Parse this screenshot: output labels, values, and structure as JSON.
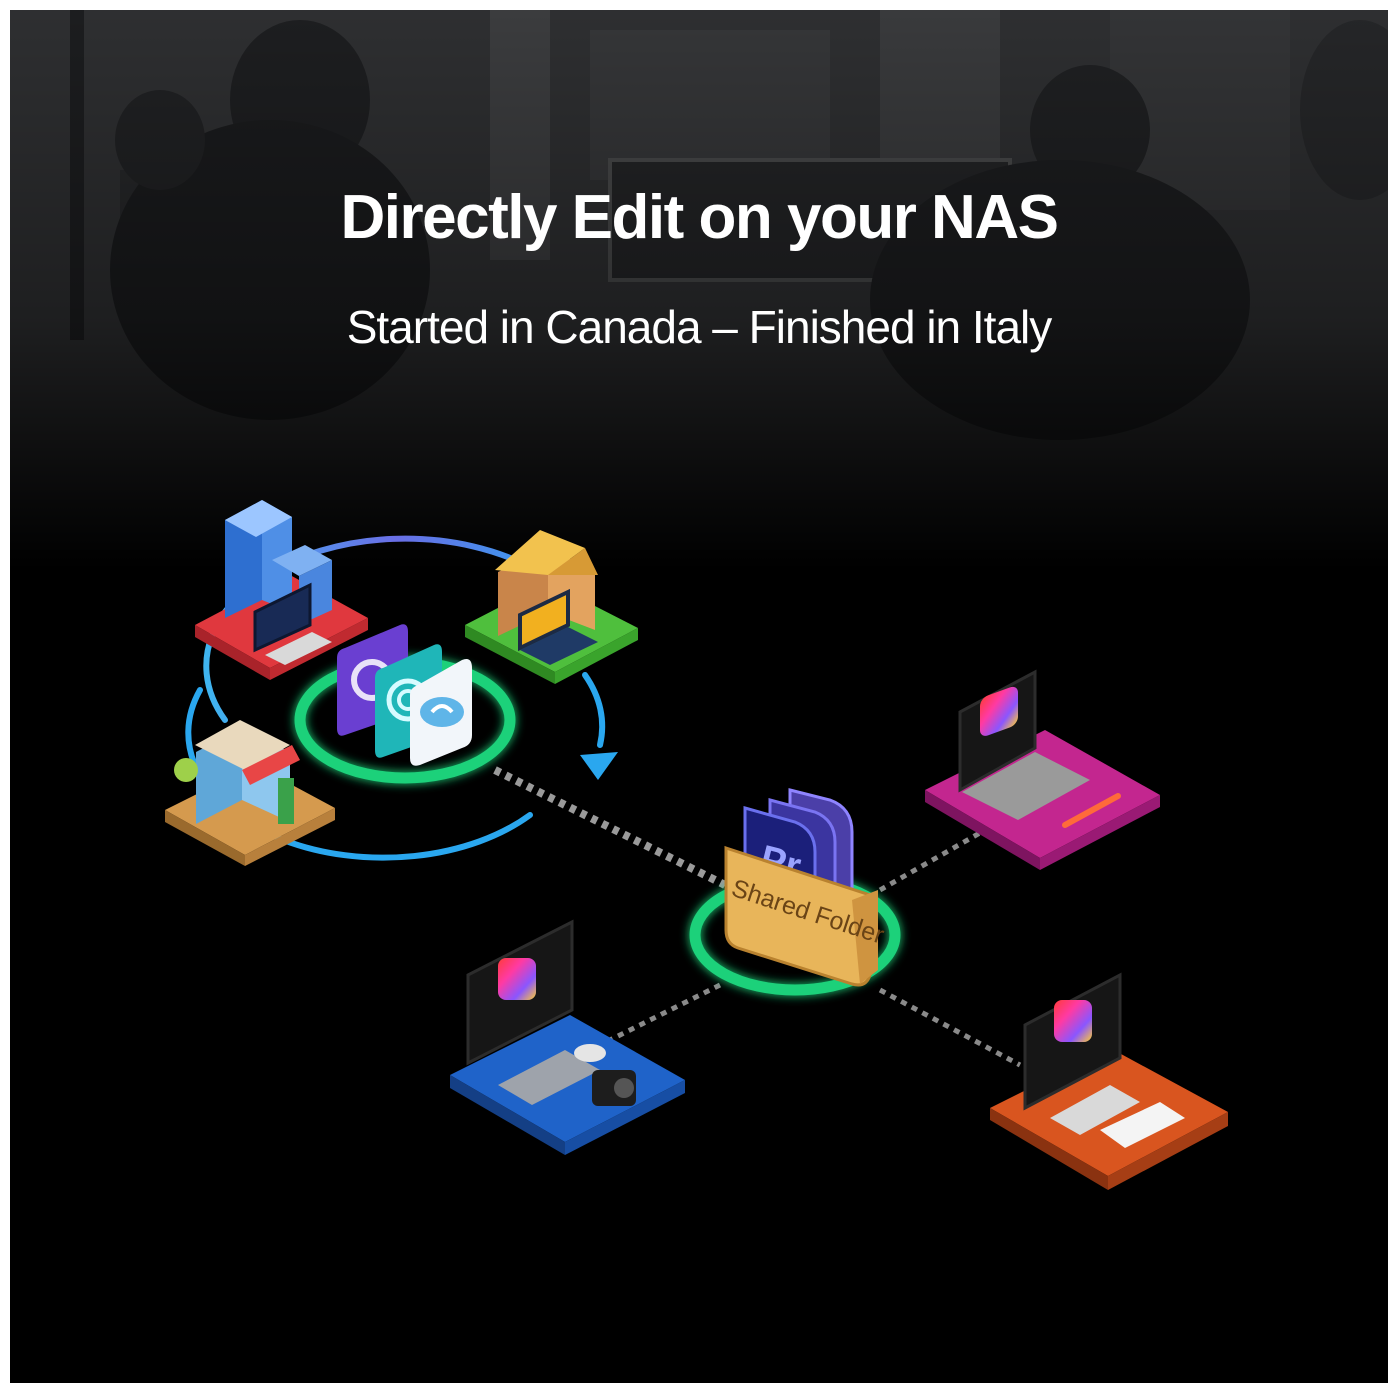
{
  "header": {
    "title": "Directly Edit on your NAS",
    "subtitle": "Started in Canada – Finished in Italy"
  },
  "diagram": {
    "shared_folder_label": "Shared Folder",
    "premiere_label": "Pr",
    "sync_hub_apps": [
      "hybrid-sync-icon",
      "resilio-sync-icon",
      "cloud-sync-icon"
    ],
    "sites": [
      "office-building",
      "house",
      "storefront"
    ],
    "workstations": [
      "pink-laptop-desk",
      "blue-imac-desk",
      "orange-imac-desk"
    ],
    "colors": {
      "hub_ring": "#1fd17a",
      "sync_arc": "#3aa7f0",
      "office_base": "#e0383e",
      "house_base": "#4fbf3d",
      "store_base": "#d59a4e",
      "pink_desk": "#c3268f",
      "blue_desk": "#1f63c9",
      "orange_desk": "#d9551f",
      "folder": "#e8b55a",
      "premiere": "#1b1f7a"
    }
  }
}
